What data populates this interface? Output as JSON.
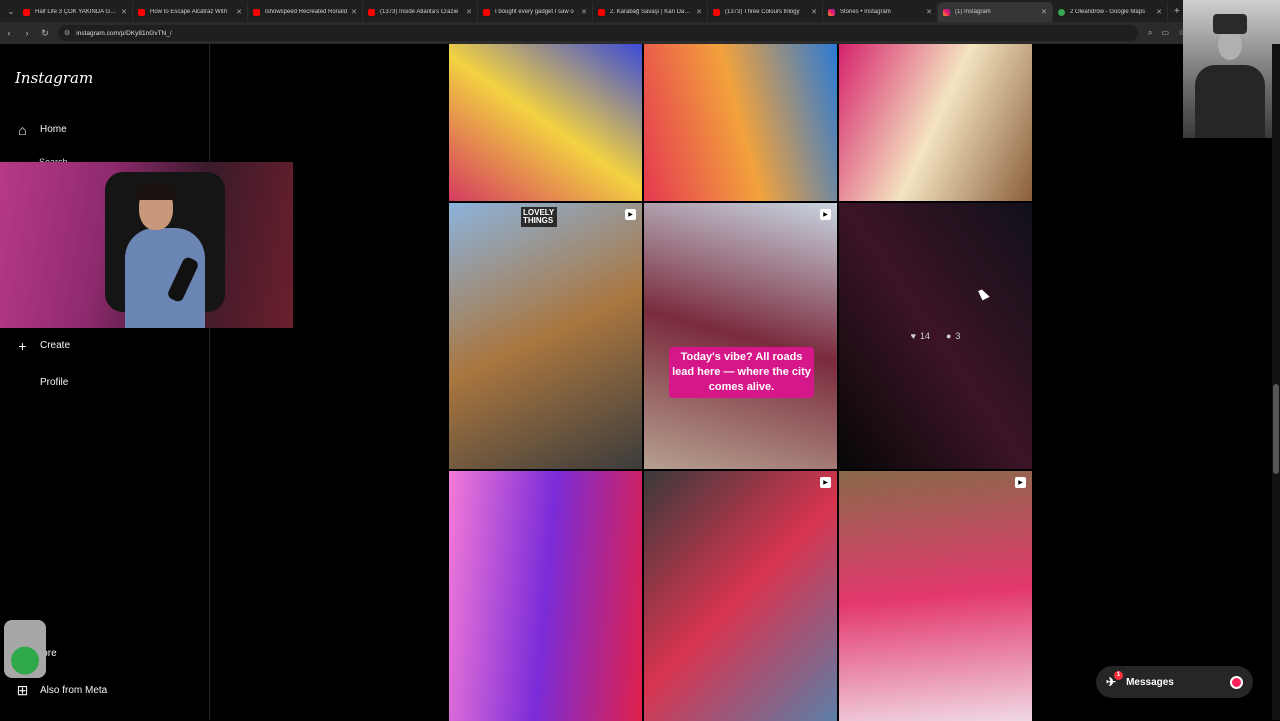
{
  "browser": {
    "tabs": [
      {
        "title": "Half Life 3 ÇOK YAKINDA Geliy",
        "favicon": "youtube",
        "active": false
      },
      {
        "title": "How to Escape Alcatraz With",
        "favicon": "youtube",
        "active": false
      },
      {
        "title": "Ishowspeed Recreated Ronald",
        "favicon": "youtube",
        "active": false
      },
      {
        "title": "(1373) Inside Atlanta's Crazie",
        "favicon": "youtube",
        "active": false
      },
      {
        "title": "I bought every gadget I saw o",
        "favicon": "youtube",
        "active": false
      },
      {
        "title": "2. Karabağ Savaşı | Kan Davas",
        "favicon": "youtube",
        "active": false
      },
      {
        "title": "(1373) Three Colours trilogy",
        "favicon": "youtube",
        "active": false
      },
      {
        "title": "Stories • Instagram",
        "favicon": "instagram",
        "active": false
      },
      {
        "title": "(1) Instagram",
        "favicon": "instagram",
        "active": true
      },
      {
        "title": "2 Oleandrów - Google Maps",
        "favicon": "maps",
        "active": false
      }
    ],
    "url": "instagram.com/p/DKy81nGvTN_/"
  },
  "sidebar": {
    "logo": "Instagram",
    "partial_label": "Search",
    "items": [
      {
        "label": "Home",
        "icon": "home-icon"
      },
      {
        "label": "Create",
        "icon": "plus-icon"
      },
      {
        "label": "Profile",
        "icon": "profile-icon"
      },
      {
        "label": "lore",
        "icon": "menu-icon"
      },
      {
        "label": "Also from Meta",
        "icon": "meta-icon"
      }
    ]
  },
  "grid": {
    "tiles": [
      {
        "name": "tile-fabric-prints",
        "reel": false,
        "colors": [
          "#d43b5f",
          "#f3d241",
          "#3b4bd8"
        ]
      },
      {
        "name": "tile-pins-wall",
        "reel": false,
        "colors": [
          "#e53950",
          "#f2a23c",
          "#2b7ad6"
        ]
      },
      {
        "name": "tile-shop-shelf",
        "reel": false,
        "colors": [
          "#d6226c",
          "#f4e4c0",
          "#8a5e3b"
        ]
      },
      {
        "name": "tile-lovely-things-storefront",
        "reel": true,
        "sign": "LOVELY THINGS",
        "colors": [
          "#8cb3dc",
          "#a9763f",
          "#3c3c3c"
        ]
      },
      {
        "name": "tile-container-shop",
        "reel": true,
        "caption": "Today's vibe? All roads lead here — where the city comes alive.",
        "colors": [
          "#c8d4e0",
          "#7a2b3d",
          "#b6a08f"
        ]
      },
      {
        "name": "tile-hovered-post",
        "reel": false,
        "likes": "14",
        "comments": "3",
        "colors": [
          "#3a3a5a",
          "#d84a8a",
          "#1a1a1a"
        ]
      },
      {
        "name": "tile-red-creature-mural",
        "reel": false,
        "colors": [
          "#e0204a",
          "#7a2bd8",
          "#f37ad8"
        ]
      },
      {
        "name": "tile-apartment-patio",
        "reel": true,
        "colors": [
          "#5b7fa8",
          "#d8344f",
          "#3a3a3a"
        ]
      },
      {
        "name": "tile-curtain-shop",
        "reel": true,
        "colors": [
          "#f0d8e4",
          "#e3386d",
          "#8a6a4a"
        ]
      }
    ]
  },
  "messages": {
    "label": "Messages",
    "badge": "1"
  }
}
